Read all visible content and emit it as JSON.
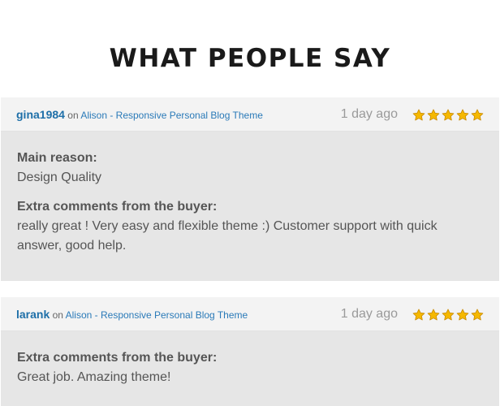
{
  "heading": "WHAT PEOPLE SAY",
  "reviews": [
    {
      "username": "gina1984",
      "on": "on",
      "product": "Alison - Responsive Personal Blog Theme",
      "date": "1 day ago",
      "rating": 5,
      "main_reason_label": "Main reason:",
      "main_reason": "Design Quality",
      "comments_label": "Extra comments from the buyer:",
      "comments": "really great ! Very easy and flexible theme :) Customer support with quick answer, good help."
    },
    {
      "username": "larank",
      "on": "on",
      "product": "Alison - Responsive Personal Blog Theme",
      "date": "1 day ago",
      "rating": 5,
      "comments_label": "Extra comments from the buyer:",
      "comments": "Great job. Amazing theme!"
    }
  ],
  "colors": {
    "star_fill": "#f5b800",
    "star_stroke": "#c98a00",
    "link": "#1e6fa8"
  },
  "icons": {
    "rating": "star-icon"
  }
}
